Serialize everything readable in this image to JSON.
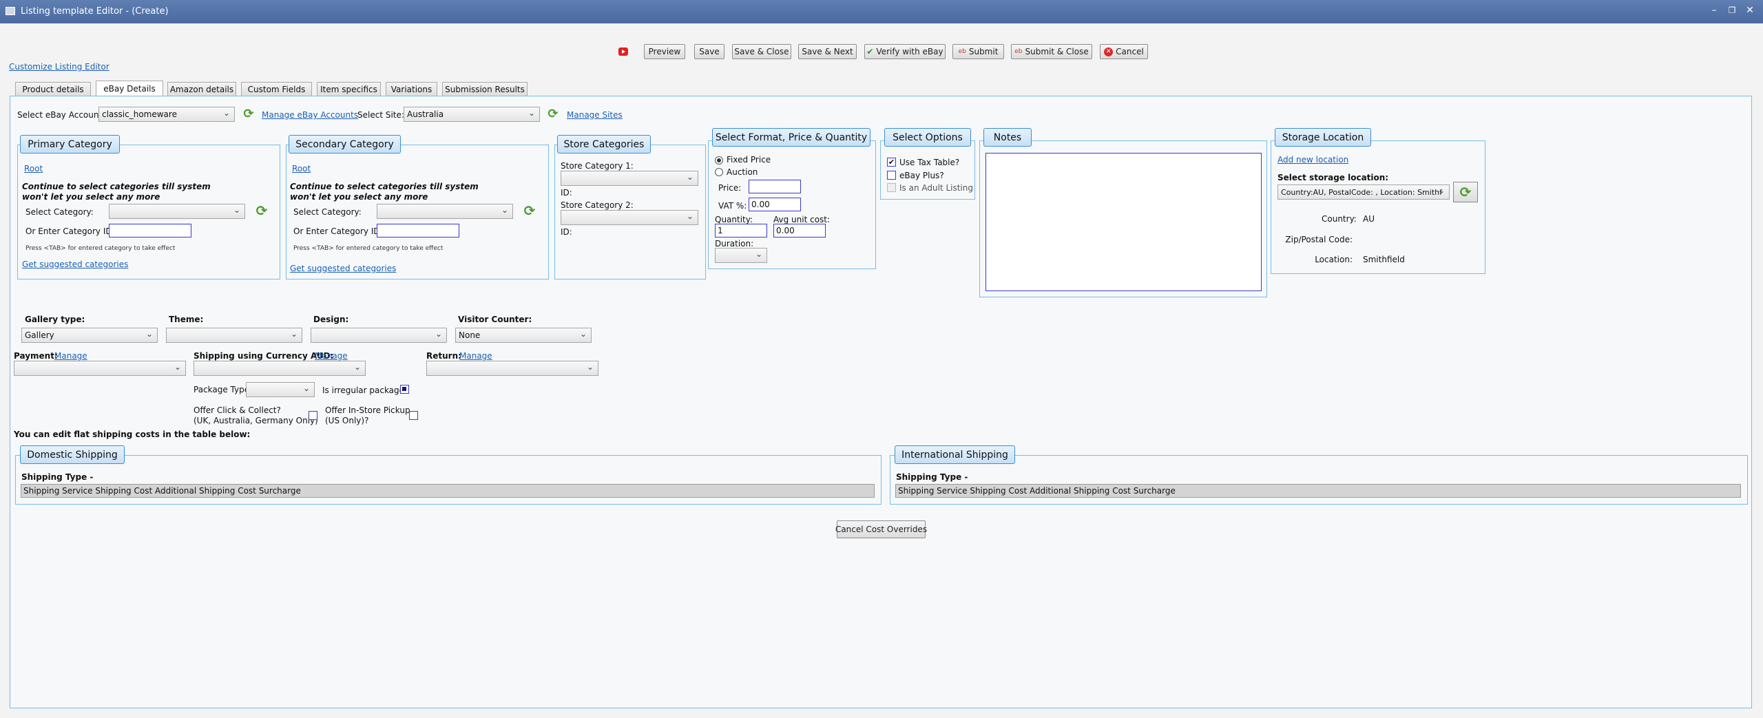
{
  "window": {
    "title": "Listing template Editor - (Create)"
  },
  "toolbar": {
    "preview": "Preview",
    "save": "Save",
    "save_close": "Save & Close",
    "save_next": "Save & Next",
    "verify": "Verify with eBay",
    "submit": "Submit",
    "submit_close": "Submit & Close",
    "cancel": "Cancel"
  },
  "customize_link": "Customize Listing Editor",
  "tabs": [
    "Product details",
    "eBay Details",
    "Amazon details",
    "Custom Fields",
    "Item specifics",
    "Variations",
    "Submission Results"
  ],
  "account": {
    "label": "Select eBay Account:",
    "value": "classic_homeware",
    "manage": "Manage eBay Accounts",
    "site_label": "Select Site:",
    "site_value": "Australia",
    "manage_sites": "Manage Sites"
  },
  "primary": {
    "title": "Primary Category",
    "root": "Root",
    "hint1": "Continue to select categories till system",
    "hint2": "won't let you select any more",
    "select_label": "Select Category:",
    "id_label": "Or Enter Category ID:",
    "tab_hint": "Press <TAB> for entered category to take effect",
    "suggested": "Get suggested categories"
  },
  "secondary": {
    "title": "Secondary Category",
    "root": "Root",
    "hint1": "Continue to select categories till system",
    "hint2": "won't let you select any more",
    "select_label": "Select Category:",
    "id_label": "Or Enter Category ID:",
    "tab_hint": "Press <TAB> for entered category to take effect",
    "suggested": "Get suggested categories"
  },
  "store": {
    "title": "Store Categories",
    "cat1": "Store Category 1:",
    "id1": "ID:",
    "cat2": "Store Category 2:",
    "id2": "ID:"
  },
  "format": {
    "title": "Select Format, Price & Quantity",
    "fixed": "Fixed Price",
    "auction": "Auction",
    "price_label": "Price:",
    "vat_label": "VAT %:",
    "vat_value": "0.00",
    "qty_label": "Quantity:",
    "qty_value": "1",
    "avg_label": "Avg unit cost:",
    "avg_value": "0.00",
    "duration_label": "Duration:"
  },
  "options": {
    "title": "Select Options",
    "tax": "Use Tax Table?",
    "plus": "eBay Plus?",
    "adult": "Is an Adult Listing"
  },
  "notes": {
    "title": "Notes"
  },
  "storage": {
    "title": "Storage Location",
    "add": "Add new location",
    "select_label": "Select storage location:",
    "select_value": "Country:AU, PostalCode: , Location: Smithf",
    "country_label": "Country:",
    "country_value": "AU",
    "zip_label": "Zip/Postal Code:",
    "location_label": "Location:",
    "location_value": "Smithfield"
  },
  "listing": {
    "gallery_label": "Gallery type:",
    "gallery_value": "Gallery",
    "theme_label": "Theme:",
    "design_label": "Design:",
    "counter_label": "Visitor Counter:",
    "counter_value": "None",
    "payment_label": "Payment:",
    "manage": "Manage",
    "shipping_label": "Shipping using Currency AUD:",
    "return_label": "Return:",
    "package_label": "Package Type:",
    "irregular_label": "Is irregular package?",
    "click_collect1": "Offer Click & Collect?",
    "click_collect2": "(UK, Australia, Germany Only)",
    "instore1": "Offer In-Store Pickup",
    "instore2": "(US Only)?",
    "flat_note": "You can edit flat shipping costs in the table below:"
  },
  "domestic": {
    "title": "Domestic Shipping",
    "type_label": "Shipping Type -",
    "columns": "Shipping Service Shipping Cost Additional Shipping Cost Surcharge"
  },
  "international": {
    "title": "International Shipping",
    "type_label": "Shipping Type -",
    "columns": "Shipping Service Shipping Cost Additional Shipping Cost Surcharge"
  },
  "cancel_overrides": "Cancel Cost Overrides",
  "colors": {
    "accent": "#3b8fd0",
    "title_bar": "#4a6aa0",
    "link": "#1a5fb4"
  }
}
